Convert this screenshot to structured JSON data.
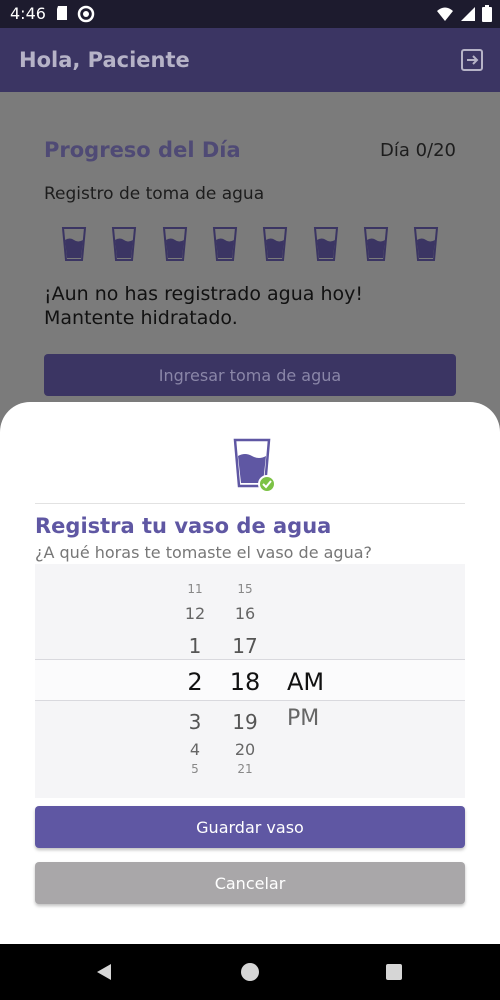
{
  "status_bar": {
    "time": "4:46",
    "icons": [
      "sd-card-icon",
      "no-disturb-icon",
      "wifi-icon",
      "signal-icon",
      "battery-icon"
    ]
  },
  "app_bar": {
    "title": "Hola, Paciente",
    "action_icon": "logout-icon"
  },
  "progress": {
    "title": "Progreso del Día",
    "day_label": "Día 0/20",
    "subtitle": "Registro de toma de agua",
    "glasses_count": 8,
    "message_line1": "¡Aun no has registrado agua hoy!",
    "message_line2": "Mantente hidratado.",
    "register_button": "Ingresar toma de agua"
  },
  "sheet": {
    "icon": "glass-check-icon",
    "title": "Registra tu vaso de agua",
    "question": "¿A qué horas te tomaste el vaso de agua?",
    "time_picker": {
      "hours": [
        "11",
        "12",
        "1",
        "2",
        "3",
        "4",
        "5"
      ],
      "minutes": [
        "15",
        "16",
        "17",
        "18",
        "19",
        "20",
        "21"
      ],
      "periods": [
        "AM",
        "PM"
      ],
      "selected_hour": "2",
      "selected_minute": "18",
      "selected_period": "AM"
    },
    "save_button": "Guardar vaso",
    "cancel_button": "Cancelar"
  },
  "colors": {
    "accent": "#5f57a3",
    "app_bar": "#3b3563",
    "cancel": "#a9a7a9"
  }
}
